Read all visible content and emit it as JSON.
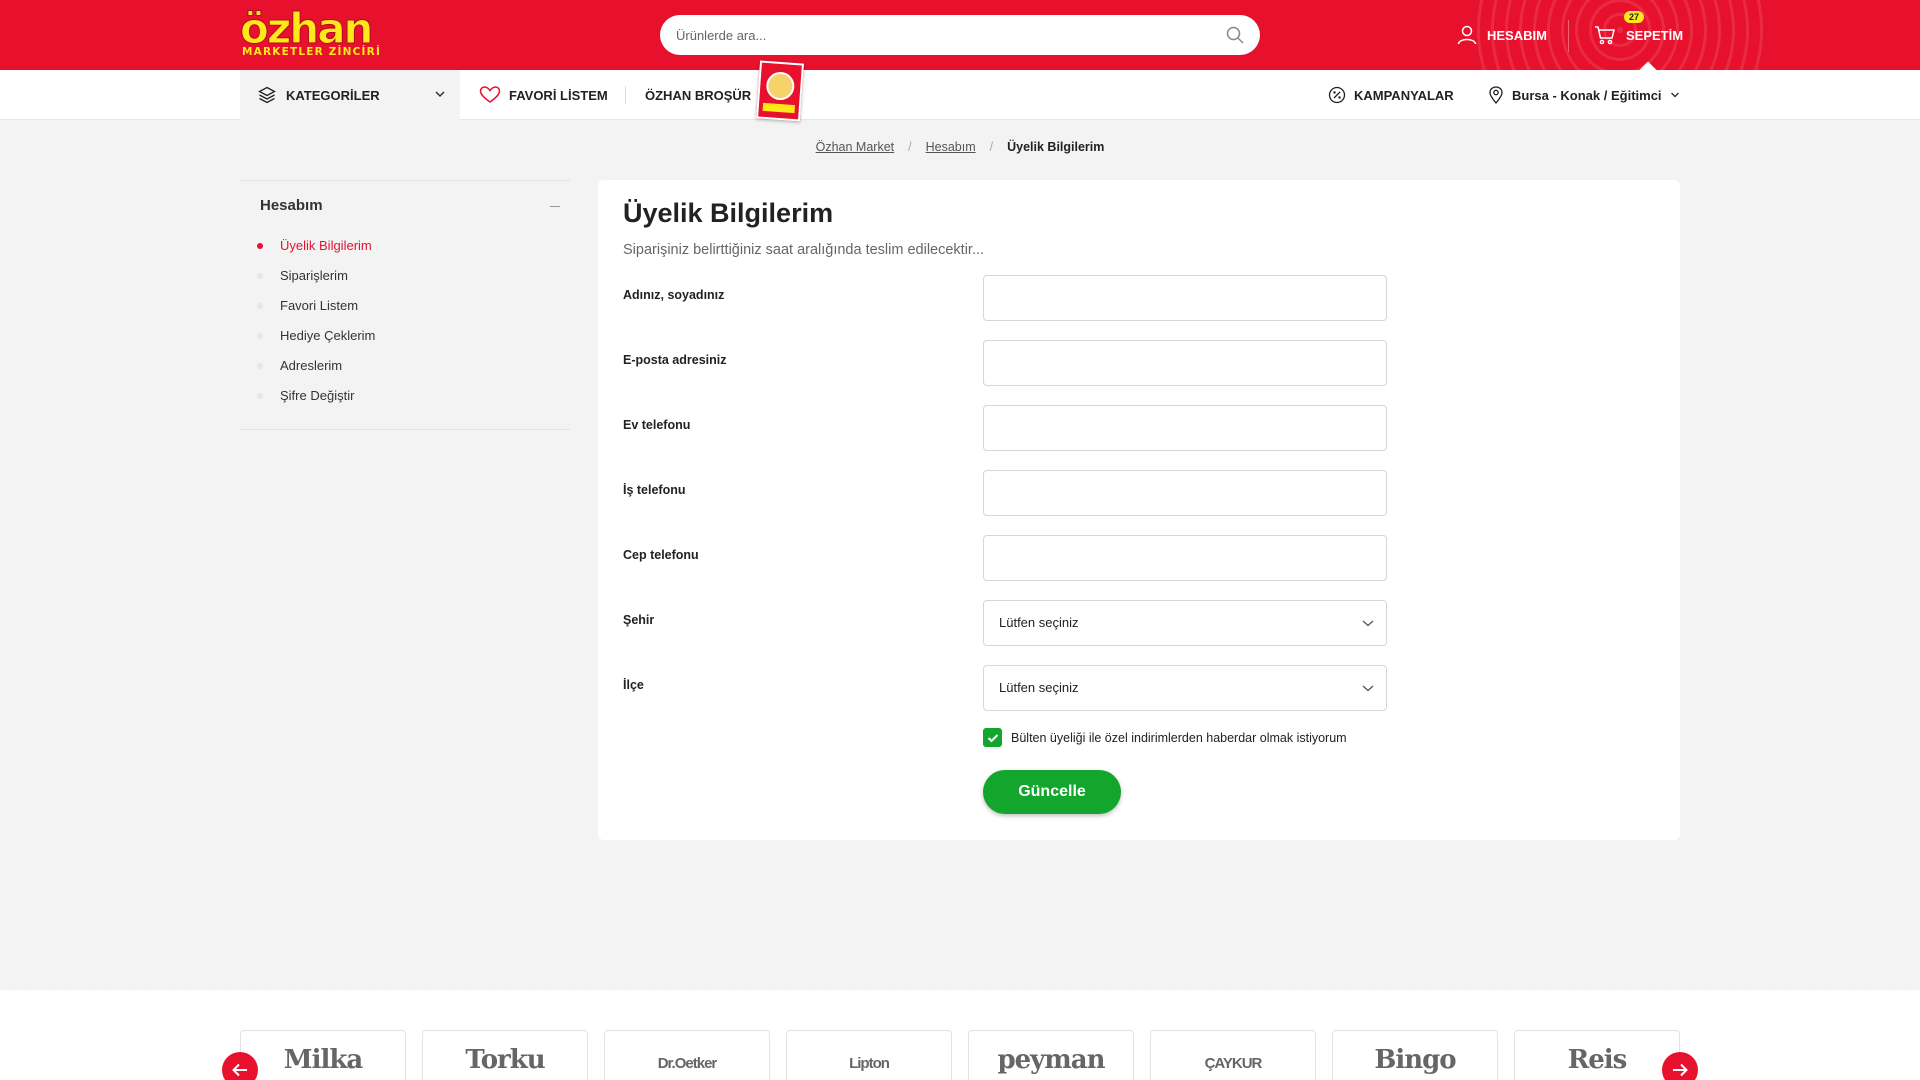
{
  "header": {
    "logo_main": "özhan",
    "logo_sub": "MARKETLER ZİNCİRİ",
    "search_placeholder": "Ürünlerde ara...",
    "account_label": "HESABIM",
    "cart_label": "SEPETİM",
    "cart_count": "27"
  },
  "nav": {
    "categories_label": "KATEGORİLER",
    "favorites_label": "FAVORİ LİSTEM",
    "brochure_label": "ÖZHAN BROŞÜR",
    "campaigns_label": "KAMPANYALAR",
    "location_label": "Bursa - Konak / Eğitimci"
  },
  "breadcrumb": {
    "items": [
      "Özhan Market",
      "Hesabım"
    ],
    "current": "Üyelik Bilgilerim"
  },
  "sidebar": {
    "title": "Hesabım",
    "items": [
      {
        "label": "Üyelik Bilgilerim",
        "active": true
      },
      {
        "label": "Siparişlerim",
        "active": false
      },
      {
        "label": "Favori Listem",
        "active": false
      },
      {
        "label": "Hediye Çeklerim",
        "active": false
      },
      {
        "label": "Adreslerim",
        "active": false
      },
      {
        "label": "Şifre Değiştir",
        "active": false
      }
    ]
  },
  "form": {
    "title": "Üyelik Bilgilerim",
    "subtitle": "Siparişiniz belirttiğiniz saat aralığında teslim edilecektir...",
    "fields": [
      {
        "label": "Adınız, soyadınız",
        "value": ""
      },
      {
        "label": "E-posta adresiniz",
        "value": ""
      },
      {
        "label": "Ev telefonu",
        "value": ""
      },
      {
        "label": "İş telefonu",
        "value": ""
      },
      {
        "label": "Cep telefonu",
        "value": ""
      }
    ],
    "city_label": "Şehir",
    "city_value": "Lütfen seçiniz",
    "district_label": "İlçe",
    "district_value": "Lütfen seçiniz",
    "newsletter_label": "Bülten üyeliği ile özel indirimlerden haberdar olmak istiyorum",
    "newsletter_checked": true,
    "submit_label": "Güncelle"
  },
  "brands": [
    "Milka",
    "Torku",
    "Dr.Oetker",
    "Lipton",
    "peyman",
    "ÇAYKUR",
    "Bingo",
    "Reis"
  ],
  "colors": {
    "brand_red": "#e8112d",
    "logo_yellow": "#ffe81a",
    "action_green": "#12a62c",
    "page_bg": "#f3f3f3"
  }
}
